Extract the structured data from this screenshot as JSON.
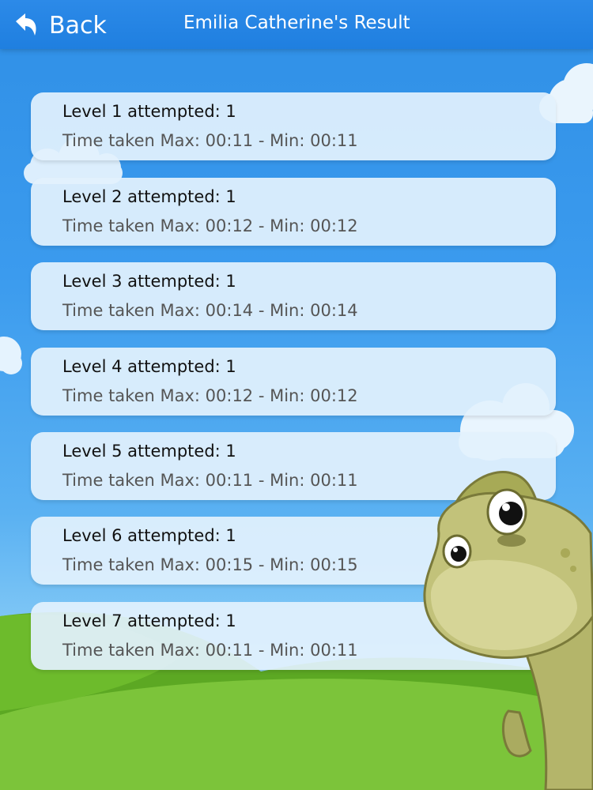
{
  "header": {
    "back_label": "Back",
    "title": "Emilia Catherine's Result"
  },
  "results": [
    {
      "attempt_label": "Level 1 attempted: 1",
      "time_label": "Time taken Max: 00:11 - Min: 00:11"
    },
    {
      "attempt_label": "Level 2 attempted: 1",
      "time_label": "Time taken Max: 00:12 - Min: 00:12"
    },
    {
      "attempt_label": "Level 3 attempted: 1",
      "time_label": "Time taken Max: 00:14 - Min: 00:14"
    },
    {
      "attempt_label": "Level 4 attempted: 1",
      "time_label": "Time taken Max: 00:12 - Min: 00:12"
    },
    {
      "attempt_label": "Level 5 attempted: 1",
      "time_label": "Time taken Max: 00:11 - Min: 00:11"
    },
    {
      "attempt_label": "Level 6 attempted: 1",
      "time_label": "Time taken Max: 00:15 - Min: 00:15"
    },
    {
      "attempt_label": "Level 7 attempted: 1",
      "time_label": "Time taken Max: 00:11 - Min: 00:11"
    }
  ],
  "icons": {
    "back": "back-arrow-icon"
  },
  "colors": {
    "header_bg": "#1f7fe0",
    "sky": "#3b9bee",
    "card_bg": "#e2f1fd",
    "grass": "#6dbb2c",
    "dino": "#b9b86a"
  }
}
